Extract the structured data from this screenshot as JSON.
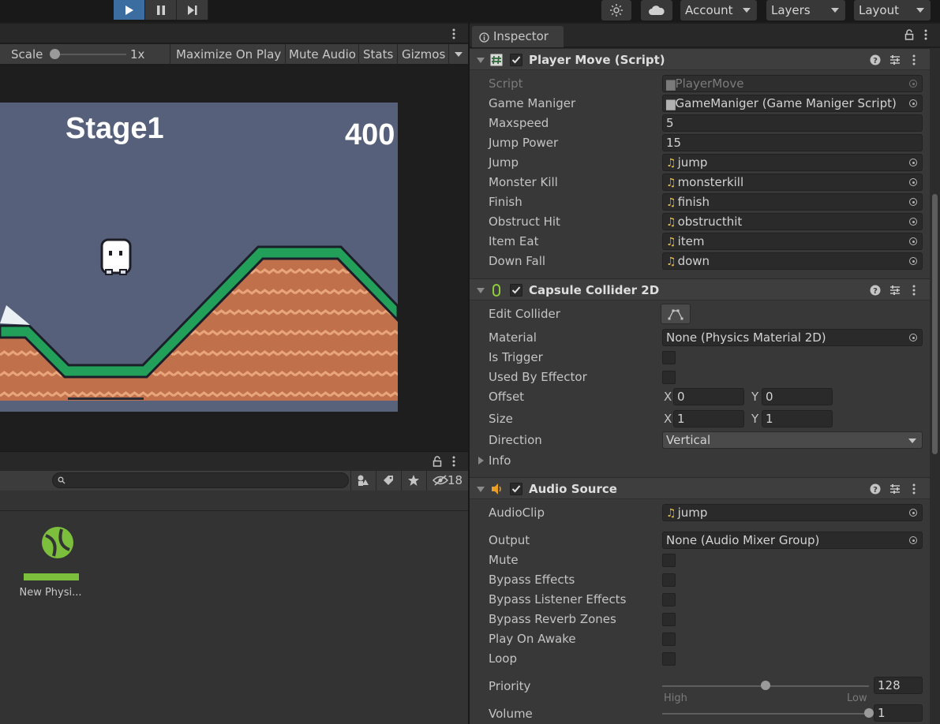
{
  "toolbar": {
    "account_label": "Account",
    "layers_label": "Layers",
    "layout_label": "Layout"
  },
  "game_view": {
    "scale_label": "Scale",
    "scale_value": "1x",
    "maximize_label": "Maximize On Play",
    "mute_label": "Mute Audio",
    "stats_label": "Stats",
    "gizmos_label": "Gizmos",
    "stage_text": "Stage1",
    "score_text": "400"
  },
  "project": {
    "search_placeholder": "",
    "hidden_count": "18",
    "asset_label": "New Physi..."
  },
  "inspector": {
    "tab_label": "Inspector",
    "player_move": {
      "title": "Player Move (Script)",
      "script_label": "Script",
      "script_value": "PlayerMove",
      "game_maniger_label": "Game Maniger",
      "game_maniger_value": "GameManiger (Game Maniger Script)",
      "maxspeed_label": "Maxspeed",
      "maxspeed_value": "5",
      "jump_power_label": "Jump Power",
      "jump_power_value": "15",
      "clips": [
        {
          "label": "Jump",
          "value": "jump"
        },
        {
          "label": "Monster Kill",
          "value": "monsterkill"
        },
        {
          "label": "Finish",
          "value": "finish"
        },
        {
          "label": "Obstruct Hit",
          "value": "obstructhit"
        },
        {
          "label": "Item Eat",
          "value": "item"
        },
        {
          "label": "Down Fall",
          "value": "down"
        }
      ]
    },
    "capsule": {
      "title": "Capsule Collider 2D",
      "edit_collider_label": "Edit Collider",
      "material_label": "Material",
      "material_value": "None (Physics Material 2D)",
      "is_trigger_label": "Is Trigger",
      "used_by_effector_label": "Used By Effector",
      "offset_label": "Offset",
      "offset_x": "0",
      "offset_y": "0",
      "size_label": "Size",
      "size_x": "1",
      "size_y": "1",
      "x_label": "X",
      "y_label": "Y",
      "direction_label": "Direction",
      "direction_value": "Vertical",
      "info_label": "Info"
    },
    "audio": {
      "title": "Audio Source",
      "audioclip_label": "AudioClip",
      "audioclip_value": "jump",
      "output_label": "Output",
      "output_value": "None (Audio Mixer Group)",
      "toggles": [
        "Mute",
        "Bypass Effects",
        "Bypass Listener Effects",
        "Bypass Reverb Zones",
        "Play On Awake",
        "Loop"
      ],
      "priority_label": "Priority",
      "priority_value": "128",
      "priority_fraction": 0.5,
      "priority_high": "High",
      "priority_low": "Low",
      "volume_label": "Volume",
      "volume_value": "1",
      "volume_fraction": 1.0
    }
  }
}
